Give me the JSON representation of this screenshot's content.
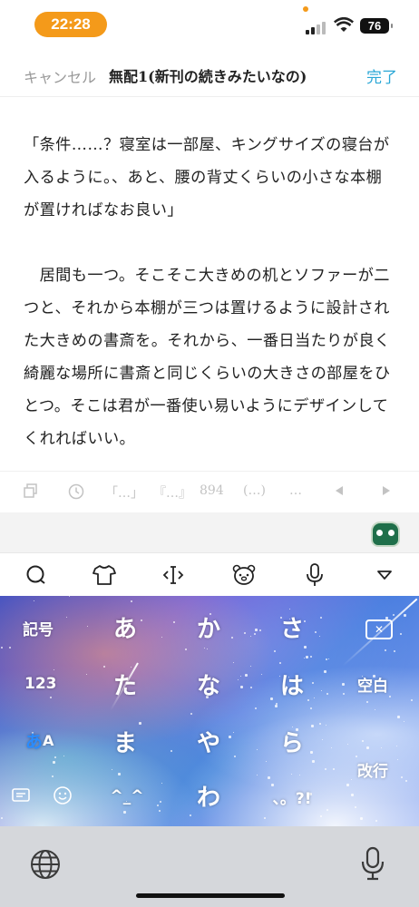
{
  "status_bar": {
    "time": "22:28",
    "battery": "76"
  },
  "header": {
    "cancel": "キャンセル",
    "title": "無配1(新刊の続きみたいなの)",
    "done": "完了"
  },
  "content": {
    "paragraph1_lines": [
      "「条件……？寝室は一部屋、キングサイズの寝台が",
      "入るように。、あと、腰の背丈くらいの小さな本棚",
      "が置ければなお良い」"
    ],
    "paragraph2_lines": [
      "　居間も一つ。そこそこ大きめの机とソファーが二",
      "つと、それから本棚が三つは置けるように設計され",
      "た大きめの書斎を。それから、一番日当たりが良く",
      "綺麗な場所に書斎と同じくらいの大きさの部屋をひ",
      "とつ。そこは君が一番使い易いようにデザインして",
      "くれればいい。"
    ]
  },
  "edit_toolbar": {
    "bracket1": "「…」",
    "bracket2": "『…』",
    "count": "894",
    "paren": "(…)",
    "ellipsis": "…",
    "icons": [
      "copy-icon",
      "clock-icon",
      "arrow-left-icon",
      "arrow-right-icon"
    ]
  },
  "keyboard_tools": {
    "icons": [
      "search-icon",
      "shirt-icon",
      "cursor-icon",
      "bear-icon",
      "mic-icon",
      "collapse-icon"
    ]
  },
  "keyboard": {
    "row1": {
      "left": "記号",
      "k1": "あ",
      "k2": "か",
      "k3": "さ",
      "right_icon": "delete-icon"
    },
    "row2": {
      "left": "123",
      "k1": "た",
      "k2": "な",
      "k3": "は",
      "right": "空白"
    },
    "row3": {
      "left_a": "あ",
      "left_b": "A",
      "k1": "ま",
      "k2": "や",
      "k3": "ら"
    },
    "row4": {
      "k1": "^_^",
      "k2": "わ",
      "k3": "、。?!",
      "right": "改行"
    }
  },
  "bottom_bar": {
    "icons": [
      "globe-icon",
      "dictation-mic-icon"
    ]
  }
}
